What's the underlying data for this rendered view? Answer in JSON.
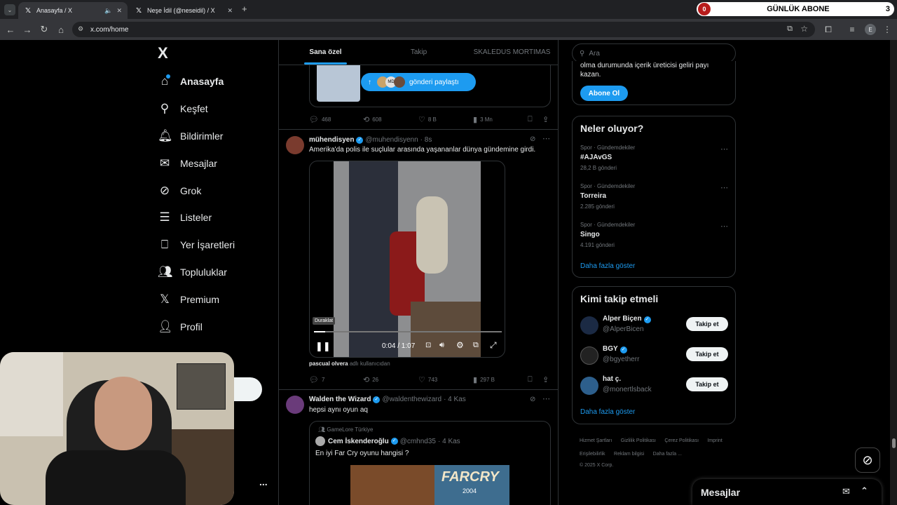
{
  "browser": {
    "tabs": [
      {
        "title": "Anasayfa / X",
        "active": true
      },
      {
        "title": "Neşe İdil (@neseidil) / X",
        "active": false
      }
    ],
    "new_tab": "+",
    "url": "x.com/home",
    "profile_initial": "E"
  },
  "overlay": {
    "sub_count": "0",
    "sub_label": "GÜNLÜK ABONE",
    "sub_target": "3"
  },
  "nav": {
    "logo": "X",
    "items": [
      {
        "label": "Anasayfa",
        "icon": "home-icon"
      },
      {
        "label": "Keşfet",
        "icon": "search-icon"
      },
      {
        "label": "Bildirimler",
        "icon": "bell-icon"
      },
      {
        "label": "Mesajlar",
        "icon": "mail-icon"
      },
      {
        "label": "Grok",
        "icon": "grok-icon"
      },
      {
        "label": "Listeler",
        "icon": "list-icon"
      },
      {
        "label": "Yer İşaretleri",
        "icon": "bookmark-icon"
      },
      {
        "label": "Topluluklar",
        "icon": "communities-icon"
      },
      {
        "label": "Premium",
        "icon": "x-icon"
      },
      {
        "label": "Profil",
        "icon": "person-icon"
      }
    ],
    "more": "..."
  },
  "center": {
    "tabs": [
      "Sana özel",
      "Takip",
      "SKALEDUS MORTIMAS"
    ],
    "share_button": "gönderi paylaştı",
    "share_initials": "MD",
    "tweet0_stats": {
      "replies": "468",
      "retweets": "608",
      "likes": "8 B",
      "views": "3 Mn"
    },
    "tweet1": {
      "name": "mühendisyen",
      "handle": "@muhendisyenn",
      "time": "· 8s",
      "text": "Amerika'da polis ile suçlular arasında yaşananlar dünya gündemine girdi.",
      "video_tooltip": "Duraklat",
      "video_time": "0:04 / 1:07",
      "tagged_name": "pascual olvera",
      "tagged_suffix": "adlı kullanıcıdan",
      "stats": {
        "replies": "7",
        "retweets": "26",
        "likes": "743",
        "views": "297 B"
      }
    },
    "tweet2": {
      "name": "Walden the Wizard",
      "handle": "@waldenthewizard",
      "time": "· 4 Kas",
      "text": "hepsi aynı oyun aq",
      "quote_community": "GameLore Türkiye",
      "quote_name": "Cem İskenderoğlu",
      "quote_handle": "@cmhnd35",
      "quote_time": "· 4 Kas",
      "quote_text": "En iyi Far Cry oyunu hangisi ?",
      "game_title": "FARCRY",
      "game_sub": "2004"
    }
  },
  "right": {
    "search_placeholder": "Ara",
    "premium_text_1": "olma durumunda içerik üreticisi geliri payı",
    "premium_text_2": "kazan.",
    "subscribe_button": "Abone Ol",
    "trends_title": "Neler oluyor?",
    "trends": [
      {
        "meta": "Spor · Gündemdekiler",
        "name": "#AJAvGS",
        "count": "28,2 B gönderi"
      },
      {
        "meta": "Spor · Gündemdekiler",
        "name": "Torreira",
        "count": "2.285 gönderi"
      },
      {
        "meta": "Spor · Gündemdekiler",
        "name": "Singo",
        "count": "4.191 gönderi"
      }
    ],
    "trends_more": "Daha fazla göster",
    "who_title": "Kimi takip etmeli",
    "who": [
      {
        "name": "Alper Biçen",
        "handle": "@AlperBicen",
        "button": "Takip et"
      },
      {
        "name": "BGY",
        "handle": "@bgyetherr",
        "button": "Takip et"
      },
      {
        "name": "hat ç.",
        "handle": "@monertlsback",
        "button": "Takip et"
      }
    ],
    "who_more": "Daha fazla göster",
    "footer": [
      "Hizmet Şartları",
      "Gizlilik Politikası",
      "Çerez Politikası",
      "Imprint",
      "Erişilebilirlik",
      "Reklam bilgisi",
      "Daha fazla ..."
    ],
    "copyright": "© 2025 X Corp."
  },
  "messages": {
    "title": "Mesajlar"
  },
  "colors": {
    "accent": "#1d9bf0",
    "background": "#000000",
    "border": "#2f3336",
    "muted": "#71767b"
  }
}
